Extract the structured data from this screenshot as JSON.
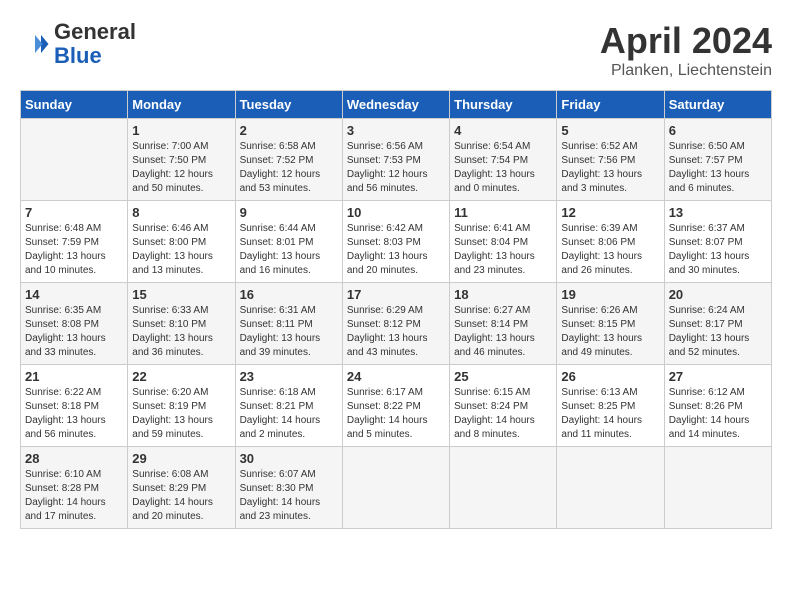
{
  "header": {
    "logo_general": "General",
    "logo_blue": "Blue",
    "month_title": "April 2024",
    "location": "Planken, Liechtenstein"
  },
  "calendar": {
    "columns": [
      "Sunday",
      "Monday",
      "Tuesday",
      "Wednesday",
      "Thursday",
      "Friday",
      "Saturday"
    ],
    "rows": [
      [
        {
          "day": "",
          "info": ""
        },
        {
          "day": "1",
          "info": "Sunrise: 7:00 AM\nSunset: 7:50 PM\nDaylight: 12 hours\nand 50 minutes."
        },
        {
          "day": "2",
          "info": "Sunrise: 6:58 AM\nSunset: 7:52 PM\nDaylight: 12 hours\nand 53 minutes."
        },
        {
          "day": "3",
          "info": "Sunrise: 6:56 AM\nSunset: 7:53 PM\nDaylight: 12 hours\nand 56 minutes."
        },
        {
          "day": "4",
          "info": "Sunrise: 6:54 AM\nSunset: 7:54 PM\nDaylight: 13 hours\nand 0 minutes."
        },
        {
          "day": "5",
          "info": "Sunrise: 6:52 AM\nSunset: 7:56 PM\nDaylight: 13 hours\nand 3 minutes."
        },
        {
          "day": "6",
          "info": "Sunrise: 6:50 AM\nSunset: 7:57 PM\nDaylight: 13 hours\nand 6 minutes."
        }
      ],
      [
        {
          "day": "7",
          "info": "Sunrise: 6:48 AM\nSunset: 7:59 PM\nDaylight: 13 hours\nand 10 minutes."
        },
        {
          "day": "8",
          "info": "Sunrise: 6:46 AM\nSunset: 8:00 PM\nDaylight: 13 hours\nand 13 minutes."
        },
        {
          "day": "9",
          "info": "Sunrise: 6:44 AM\nSunset: 8:01 PM\nDaylight: 13 hours\nand 16 minutes."
        },
        {
          "day": "10",
          "info": "Sunrise: 6:42 AM\nSunset: 8:03 PM\nDaylight: 13 hours\nand 20 minutes."
        },
        {
          "day": "11",
          "info": "Sunrise: 6:41 AM\nSunset: 8:04 PM\nDaylight: 13 hours\nand 23 minutes."
        },
        {
          "day": "12",
          "info": "Sunrise: 6:39 AM\nSunset: 8:06 PM\nDaylight: 13 hours\nand 26 minutes."
        },
        {
          "day": "13",
          "info": "Sunrise: 6:37 AM\nSunset: 8:07 PM\nDaylight: 13 hours\nand 30 minutes."
        }
      ],
      [
        {
          "day": "14",
          "info": "Sunrise: 6:35 AM\nSunset: 8:08 PM\nDaylight: 13 hours\nand 33 minutes."
        },
        {
          "day": "15",
          "info": "Sunrise: 6:33 AM\nSunset: 8:10 PM\nDaylight: 13 hours\nand 36 minutes."
        },
        {
          "day": "16",
          "info": "Sunrise: 6:31 AM\nSunset: 8:11 PM\nDaylight: 13 hours\nand 39 minutes."
        },
        {
          "day": "17",
          "info": "Sunrise: 6:29 AM\nSunset: 8:12 PM\nDaylight: 13 hours\nand 43 minutes."
        },
        {
          "day": "18",
          "info": "Sunrise: 6:27 AM\nSunset: 8:14 PM\nDaylight: 13 hours\nand 46 minutes."
        },
        {
          "day": "19",
          "info": "Sunrise: 6:26 AM\nSunset: 8:15 PM\nDaylight: 13 hours\nand 49 minutes."
        },
        {
          "day": "20",
          "info": "Sunrise: 6:24 AM\nSunset: 8:17 PM\nDaylight: 13 hours\nand 52 minutes."
        }
      ],
      [
        {
          "day": "21",
          "info": "Sunrise: 6:22 AM\nSunset: 8:18 PM\nDaylight: 13 hours\nand 56 minutes."
        },
        {
          "day": "22",
          "info": "Sunrise: 6:20 AM\nSunset: 8:19 PM\nDaylight: 13 hours\nand 59 minutes."
        },
        {
          "day": "23",
          "info": "Sunrise: 6:18 AM\nSunset: 8:21 PM\nDaylight: 14 hours\nand 2 minutes."
        },
        {
          "day": "24",
          "info": "Sunrise: 6:17 AM\nSunset: 8:22 PM\nDaylight: 14 hours\nand 5 minutes."
        },
        {
          "day": "25",
          "info": "Sunrise: 6:15 AM\nSunset: 8:24 PM\nDaylight: 14 hours\nand 8 minutes."
        },
        {
          "day": "26",
          "info": "Sunrise: 6:13 AM\nSunset: 8:25 PM\nDaylight: 14 hours\nand 11 minutes."
        },
        {
          "day": "27",
          "info": "Sunrise: 6:12 AM\nSunset: 8:26 PM\nDaylight: 14 hours\nand 14 minutes."
        }
      ],
      [
        {
          "day": "28",
          "info": "Sunrise: 6:10 AM\nSunset: 8:28 PM\nDaylight: 14 hours\nand 17 minutes."
        },
        {
          "day": "29",
          "info": "Sunrise: 6:08 AM\nSunset: 8:29 PM\nDaylight: 14 hours\nand 20 minutes."
        },
        {
          "day": "30",
          "info": "Sunrise: 6:07 AM\nSunset: 8:30 PM\nDaylight: 14 hours\nand 23 minutes."
        },
        {
          "day": "",
          "info": ""
        },
        {
          "day": "",
          "info": ""
        },
        {
          "day": "",
          "info": ""
        },
        {
          "day": "",
          "info": ""
        }
      ]
    ]
  }
}
